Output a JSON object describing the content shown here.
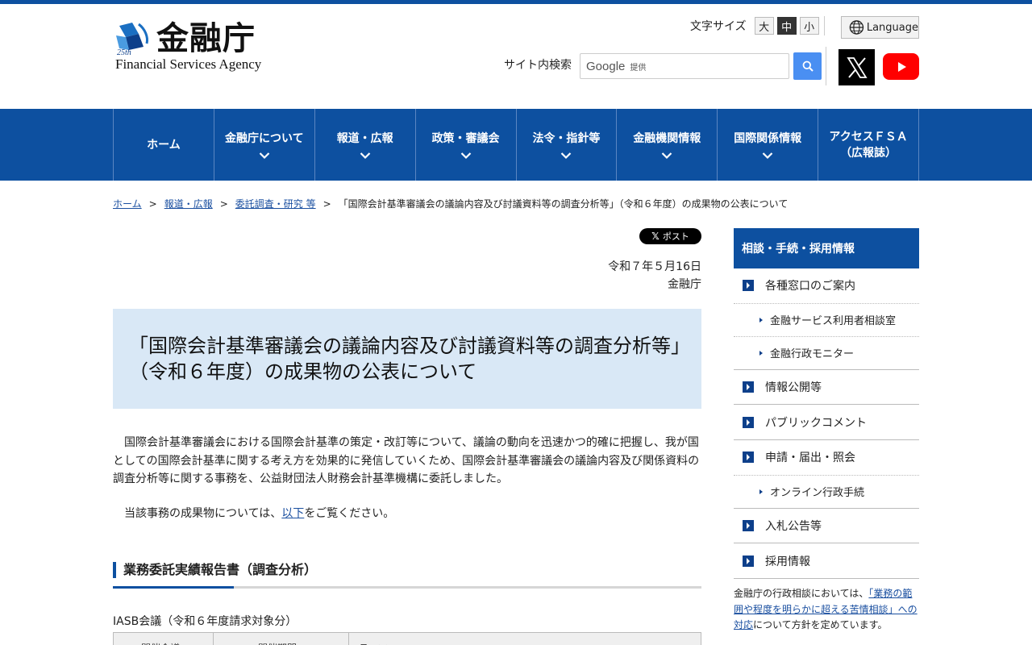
{
  "header": {
    "logo_kanji": "金融庁",
    "logo_en": "Financial Services Agency",
    "logo_badge": "25th",
    "font_size_label": "文字サイズ",
    "font_sizes": [
      "大",
      "中",
      "小"
    ],
    "font_size_selected": "中",
    "language_label": "Language",
    "search_label": "サイト内検索",
    "search_brand": "Google",
    "search_brand_sub": "提供",
    "social": [
      "x-icon",
      "youtube-icon"
    ]
  },
  "nav": [
    {
      "label": "ホーム",
      "has_menu": false
    },
    {
      "label": "金融庁について",
      "has_menu": true
    },
    {
      "label": "報道・広報",
      "has_menu": true
    },
    {
      "label": "政策・審議会",
      "has_menu": true
    },
    {
      "label": "法令・指針等",
      "has_menu": true
    },
    {
      "label": "金融機関情報",
      "has_menu": true
    },
    {
      "label": "国際関係情報",
      "has_menu": true
    },
    {
      "label": "アクセスＦＳＡ\n（広報誌）",
      "has_menu": false
    }
  ],
  "breadcrumb": {
    "items": [
      "ホーム",
      "報道・広報",
      "委託調査・研究 等"
    ],
    "current": "「国際会計基準審議会の議論内容及び討議資料等の調査分析等」（令和６年度）の成果物の公表について",
    "separator": ">"
  },
  "main": {
    "post_button": "ポスト",
    "date": "令和７年５月16日",
    "org": "金融庁",
    "title": "「国際会計基準審議会の議論内容及び討議資料等の調査分析等」（令和６年度）の成果物の公表について",
    "paragraph1": "国際会計基準審議会における国際会計基準の策定・改訂等について、議論の動向を迅速かつ的確に把握し、我が国としての国際会計基準に関する考え方を効果的に発信していくため、国際会計基準審議会の議論内容及び関係資料の調査分析等に関する事務を、公益財団法人財務会計基準機構に委託しました。",
    "paragraph2_before": "当該事務の成果物については、",
    "paragraph2_link": "以下",
    "paragraph2_after": "をご覧ください。",
    "section_heading": "業務委託実績報告書（調査分析）",
    "table_caption": "IASB会議（令和６年度請求対象分）",
    "table_headers": [
      "開催会議",
      "開催期間",
      "テーマ"
    ]
  },
  "sidebar": {
    "heading": "相談・手続・採用情報",
    "items": [
      {
        "label": "各種窓口のご案内",
        "sub": [
          "金融サービス利用者相談室",
          "金融行政モニター"
        ]
      },
      {
        "label": "情報公開等",
        "sub": []
      },
      {
        "label": "パブリックコメント",
        "sub": []
      },
      {
        "label": "申請・届出・照会",
        "sub": [
          "オンライン行政手続"
        ]
      },
      {
        "label": "入札公告等",
        "sub": []
      },
      {
        "label": "採用情報",
        "sub": []
      }
    ],
    "note_before": "金融庁の行政相談においては、",
    "note_link": "「業務の範囲や程度を明らかに超える苦情相談」への対応",
    "note_after": "について方針を定めています。"
  },
  "colors": {
    "brand_blue": "#0d50a0",
    "title_bg": "#d9e8f6",
    "link": "#1a4fa0"
  }
}
